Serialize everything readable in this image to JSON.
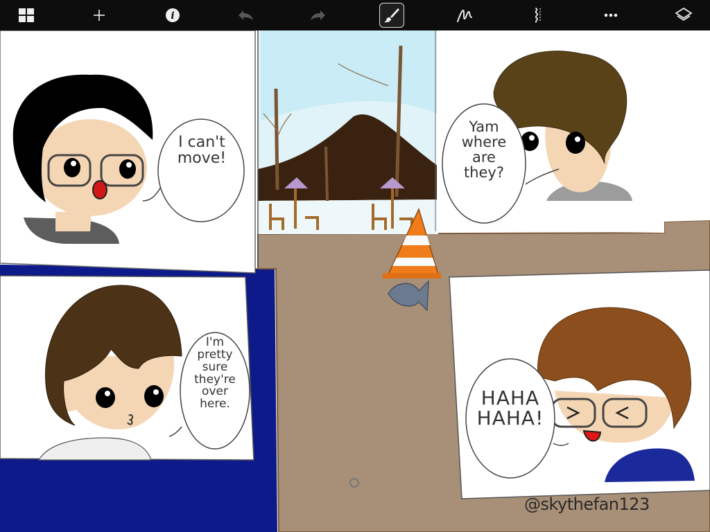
{
  "toolbar": {
    "items": [
      {
        "icon": "gallery-grid-icon",
        "active": false,
        "disabled": false
      },
      {
        "icon": "plus-icon",
        "active": false,
        "disabled": false
      },
      {
        "icon": "info-icon",
        "active": false,
        "disabled": false
      },
      {
        "icon": "undo-icon",
        "active": false,
        "disabled": true
      },
      {
        "icon": "redo-icon",
        "active": false,
        "disabled": true
      },
      {
        "icon": "brush-icon",
        "active": true,
        "disabled": false
      },
      {
        "icon": "smudge-icon",
        "active": false,
        "disabled": false
      },
      {
        "icon": "eraser-icon",
        "active": false,
        "disabled": false
      },
      {
        "icon": "more-icon",
        "active": false,
        "disabled": false
      },
      {
        "icon": "layers-icon",
        "active": false,
        "disabled": false
      }
    ]
  },
  "comic": {
    "panel1_bubble": "I can't\nmove!",
    "panel2_bubble": "Yam\nwhere\nare\nthey?",
    "panel3_bubble": "I'm\npretty\nsure\nthey're\nover\nhere.",
    "panel4_bubble": "HAHA\nHAHA!",
    "signature": "@skythefan123"
  },
  "colors": {
    "toolbar_bg": "#0d0d0d",
    "floor": "#a88f77",
    "sky": "#dff3f9",
    "mountain": "#3a2210",
    "blue_wall": "#0c1a8a",
    "cone": "#f07d1a"
  }
}
